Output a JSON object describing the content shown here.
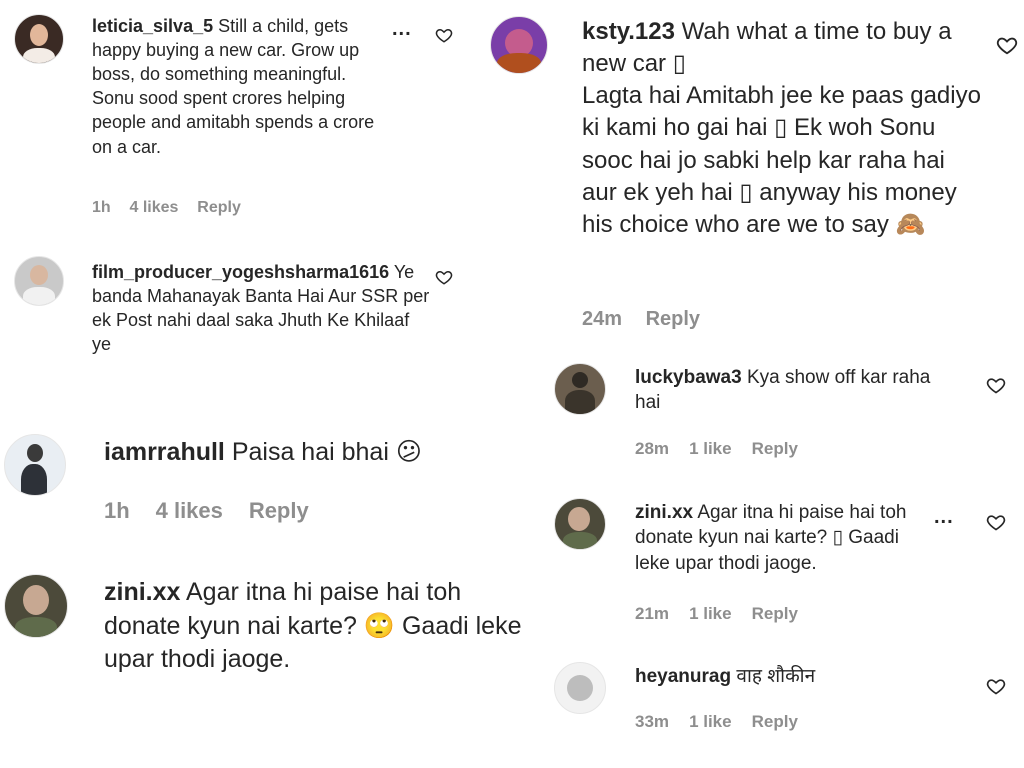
{
  "left": [
    {
      "username": "leticia_silva_5",
      "text": "Still a child, gets happy buying a new car. Grow up boss, do something meaningful. Sonu sood spent crores helping people and amitabh spends a crore on a car.",
      "time": "1h",
      "likes": "4 likes",
      "reply": "Reply",
      "more": "..."
    },
    {
      "username": "film_producer_yogeshsharma1616",
      "text": "Ye banda Mahanayak Banta Hai Aur SSR per ek Post nahi daal saka Jhuth Ke Khilaaf ye"
    },
    {
      "username": "iamrrahull",
      "text": "Paisa hai bhai 😕",
      "time": "1h",
      "likes": "4 likes",
      "reply": "Reply"
    },
    {
      "username": "zini.xx",
      "text": "Agar itna hi paise hai toh donate kyun nai karte? 🙄 Gaadi leke upar thodi jaoge."
    }
  ],
  "right": [
    {
      "username": "ksty.123",
      "text": "Wah what a time to buy a new car ▯",
      "text2": "Lagta hai Amitabh jee ke paas gadiyo ki kami ho gai hai ▯ Ek woh Sonu sooc hai jo sabki help kar raha hai aur ek yeh hai ▯ anyway his money his choice who are we to say 🙈",
      "time": "24m",
      "reply": "Reply"
    },
    {
      "username": "luckybawa3",
      "text": "Kya show off kar raha hai",
      "time": "28m",
      "likes": "1 like",
      "reply": "Reply"
    },
    {
      "username": "zini.xx",
      "text": "Agar itna hi paise hai toh donate kyun nai karte? ▯ Gaadi leke upar thodi jaoge.",
      "time": "21m",
      "likes": "1 like",
      "reply": "Reply",
      "more": "..."
    },
    {
      "username": "heyanurag",
      "text": "वाह शौकीन",
      "time": "33m",
      "likes": "1 like",
      "reply": "Reply"
    }
  ],
  "colors": {
    "text": "#262626",
    "meta": "#8e8e8e",
    "background": "#ffffff"
  },
  "icons": {
    "like": "heart-outline-icon",
    "more": "more-options-icon"
  }
}
